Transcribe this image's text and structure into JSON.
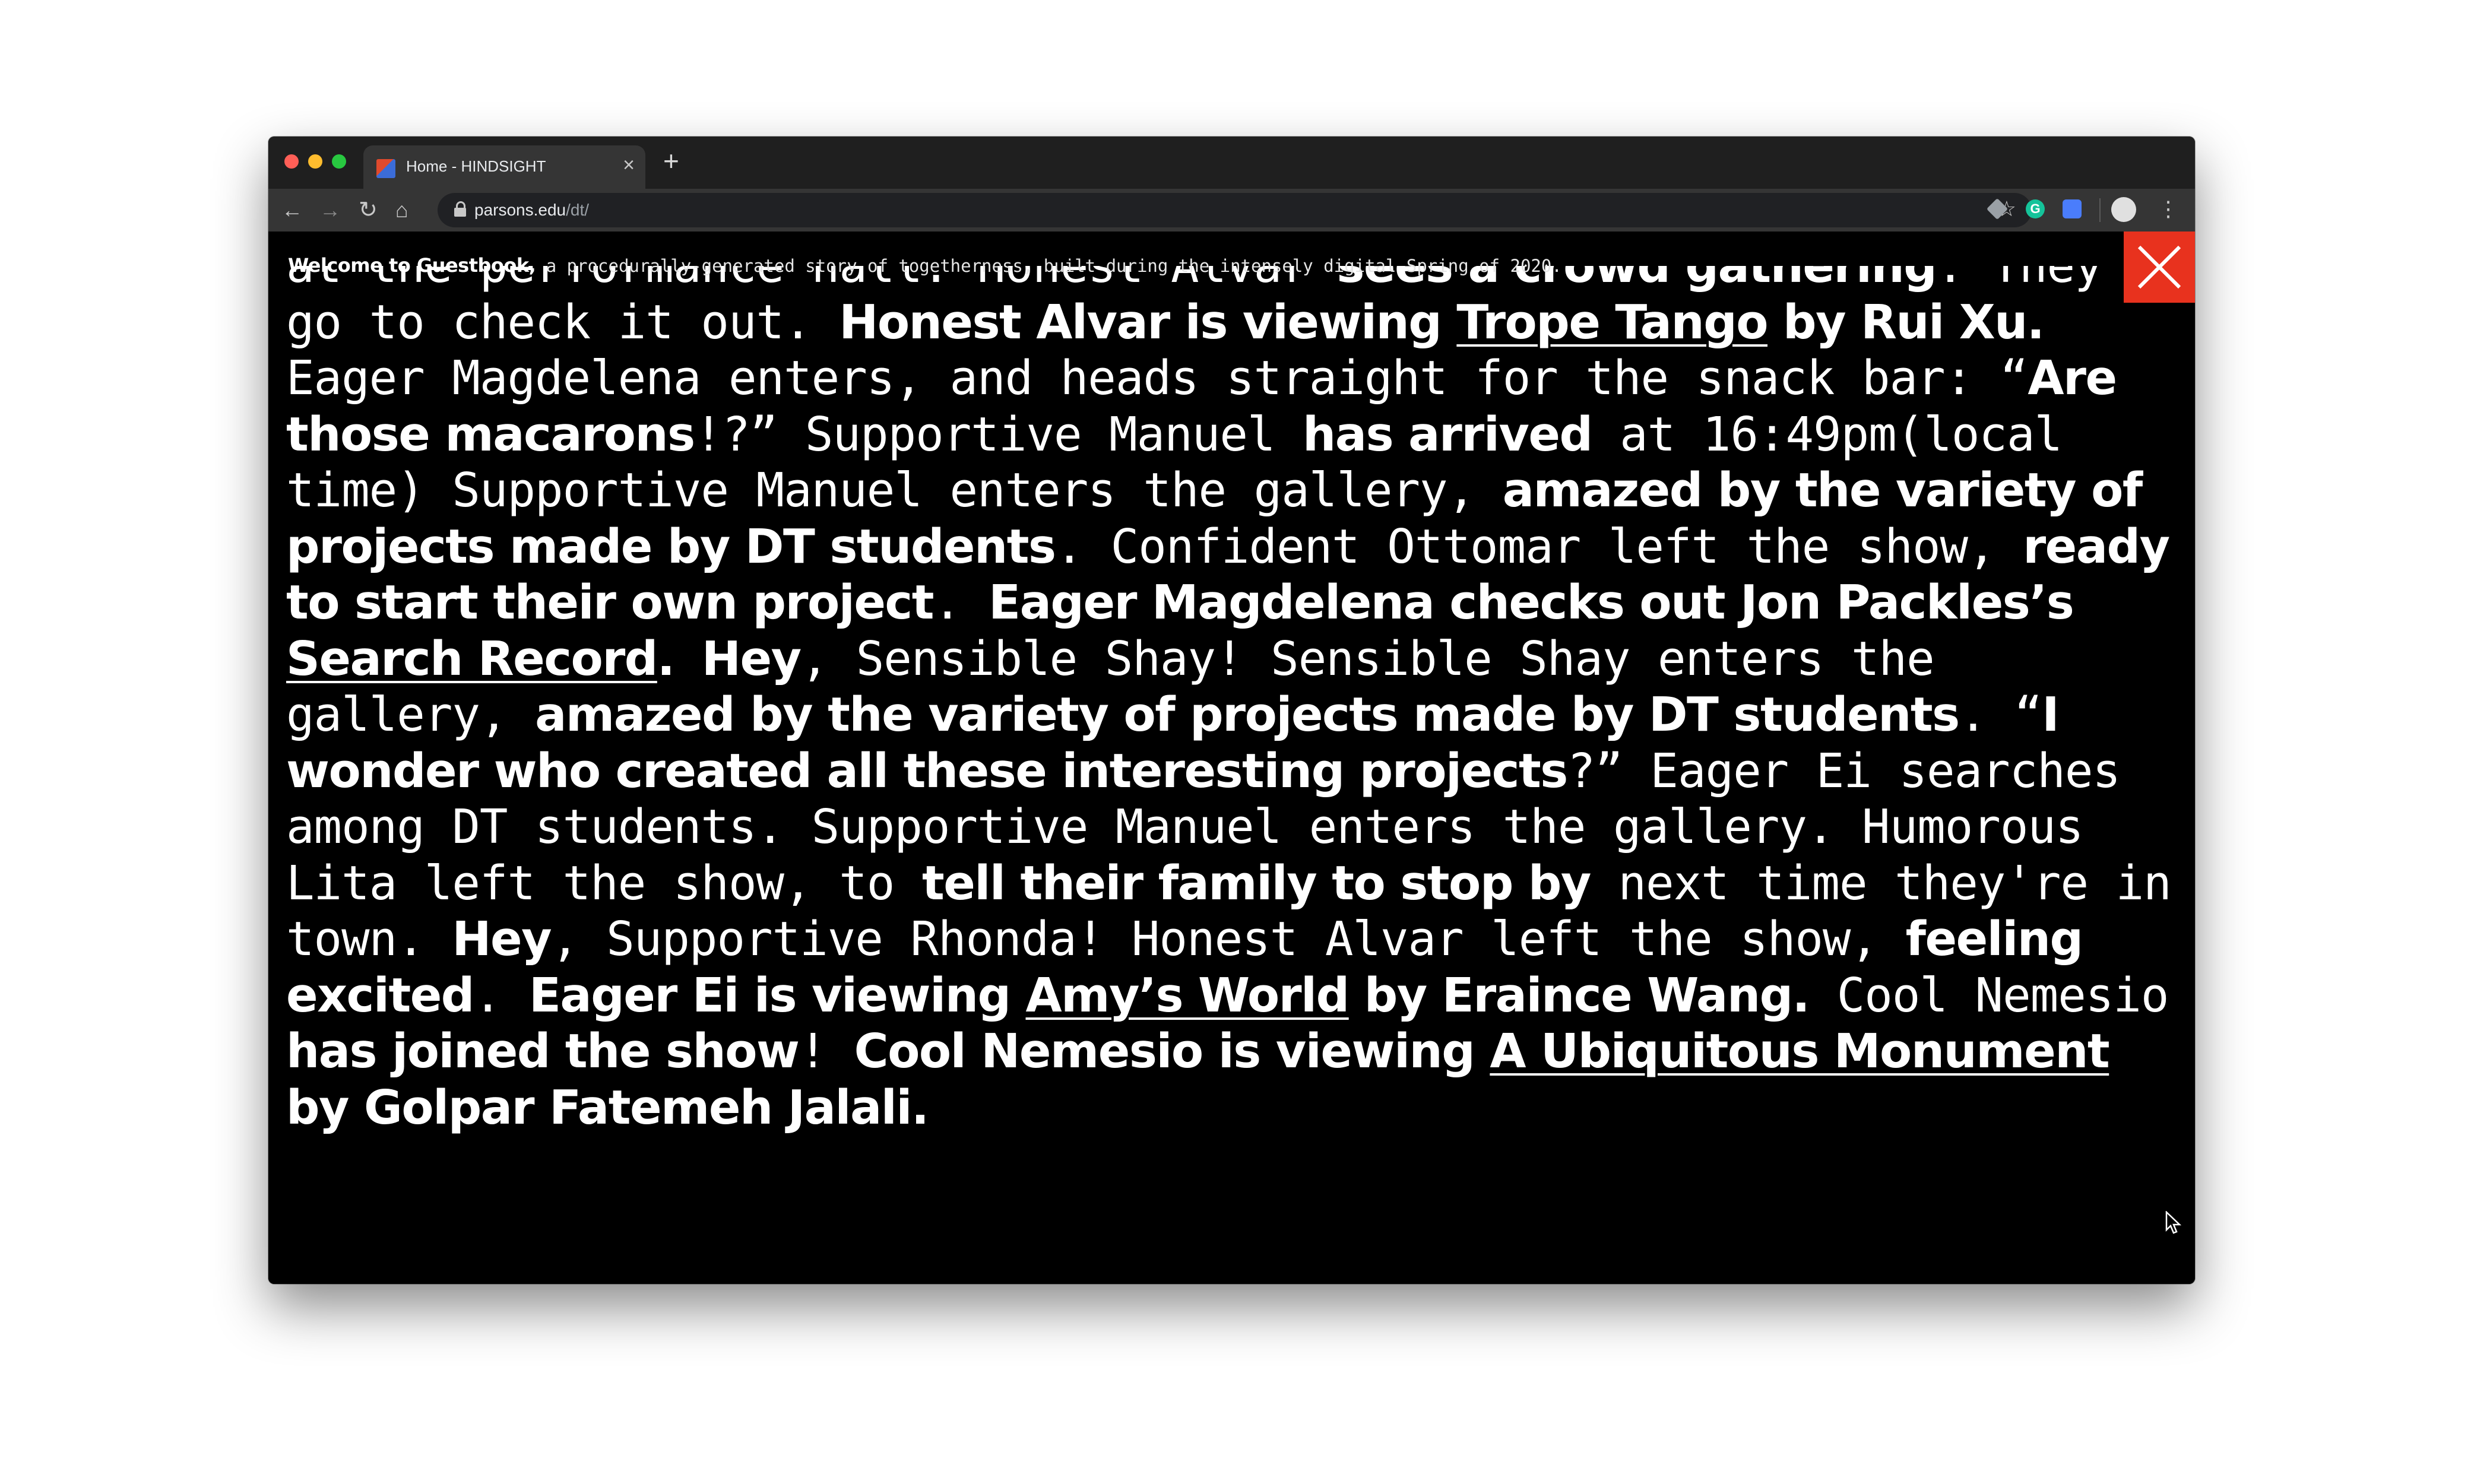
{
  "browser": {
    "tab_title": "Home - HINDSIGHT",
    "tab_close": "×",
    "new_tab": "+",
    "url_host": "parsons.edu",
    "url_path": "/dt/",
    "icons": [
      "back-icon",
      "forward-icon",
      "reload-icon",
      "home-icon",
      "lock-icon",
      "star-icon",
      "google-drive-icon",
      "grammarly-icon",
      "extension-icon",
      "profile-avatar",
      "more-menu-icon"
    ],
    "traffic_lights": [
      "#ff5f57",
      "#febc2e",
      "#28c840"
    ]
  },
  "page": {
    "welcome_bold": "Welcome to Guestbook,",
    "welcome_text": " a procedurally-generated story of togetherness, built during the intensely digital Spring of 2020.",
    "close_color": "#e8321e",
    "story": [
      {
        "t": "at the performance hall. Honest Alvar ",
        "s": "p"
      },
      {
        "t": "sees a crowd gathering",
        "s": "b"
      },
      {
        "t": ". They go to check it out. ",
        "s": "p"
      },
      {
        "t": "Honest Alvar is viewing ",
        "s": "b"
      },
      {
        "t": "Trope Tango",
        "s": "link"
      },
      {
        "t": " by Rui Xu.",
        "s": "b"
      },
      {
        "t": " Eager Magdelena enters, and heads straight for the snack bar: “",
        "s": "p"
      },
      {
        "t": "Are those macarons",
        "s": "b"
      },
      {
        "t": "!?” Supportive Manuel ",
        "s": "p"
      },
      {
        "t": "has arrived",
        "s": "b"
      },
      {
        "t": " at 16:49pm(local time) Supportive Manuel enters the gallery, ",
        "s": "p"
      },
      {
        "t": "amazed by the variety of projects made by DT students",
        "s": "b"
      },
      {
        "t": ". Confident Ottomar left the show, ",
        "s": "p"
      },
      {
        "t": "ready to start their own project",
        "s": "b"
      },
      {
        "t": ". ",
        "s": "p"
      },
      {
        "t": "Eager Magdelena checks out Jon Packles’s ",
        "s": "b"
      },
      {
        "t": "Search Record",
        "s": "link"
      },
      {
        "t": ".",
        "s": "b"
      },
      {
        "t": " ",
        "s": "p"
      },
      {
        "t": "Hey",
        "s": "b"
      },
      {
        "t": ", Sensible Shay! Sensible Shay enters the gallery, ",
        "s": "p"
      },
      {
        "t": "amazed by the variety of projects made by DT students",
        "s": "b"
      },
      {
        "t": ". “",
        "s": "p"
      },
      {
        "t": "I wonder who created all these interesting projects",
        "s": "b"
      },
      {
        "t": "?” Eager Ei searches among DT students. Supportive Manuel enters the gallery. Humorous Lita left the show, to ",
        "s": "p"
      },
      {
        "t": "tell their family to stop by",
        "s": "b"
      },
      {
        "t": " next time they're in town. ",
        "s": "p"
      },
      {
        "t": "Hey",
        "s": "b"
      },
      {
        "t": ", Supportive Rhonda! Honest Alvar left the show, ",
        "s": "p"
      },
      {
        "t": "feeling excited",
        "s": "b"
      },
      {
        "t": ". ",
        "s": "p"
      },
      {
        "t": "Eager Ei is viewing ",
        "s": "b"
      },
      {
        "t": "Amy’s World",
        "s": "link"
      },
      {
        "t": " by Eraince Wang.",
        "s": "b"
      },
      {
        "t": " Cool Nemesio ",
        "s": "p"
      },
      {
        "t": "has joined the show",
        "s": "b"
      },
      {
        "t": "! ",
        "s": "p"
      },
      {
        "t": "Cool Nemesio is viewing ",
        "s": "b"
      },
      {
        "t": "A Ubiquitous Monument",
        "s": "link"
      },
      {
        "t": " by Golpar Fatemeh Jalali.",
        "s": "b"
      }
    ]
  }
}
